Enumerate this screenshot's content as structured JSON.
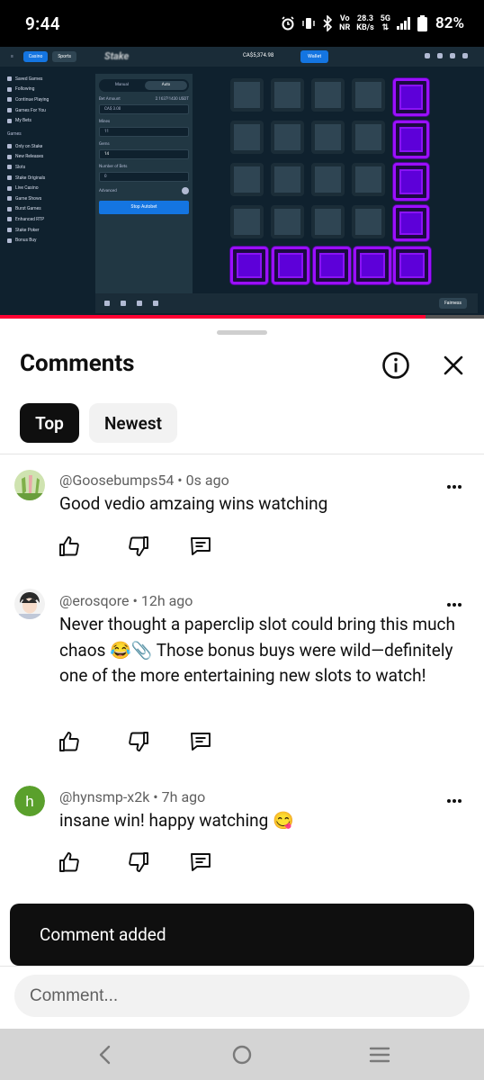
{
  "status_bar": {
    "time": "9:44",
    "net_speed_value": "28.3",
    "net_speed_unit": "KB/s",
    "vo_label": "Vo",
    "nr_label": "NR",
    "five_g_label": "5G",
    "battery": "82%"
  },
  "video": {
    "progress": 0.88,
    "stake_ui": {
      "tabs": [
        "Casino",
        "Sports"
      ],
      "logo": "Stake",
      "balance": "CA$5,374.98",
      "wallet_label": "Wallet",
      "sidebar_items": [
        "Saved Games",
        "Following",
        "Continue Playing",
        "Games For You",
        "My Bets"
      ],
      "sidebar_section": "Games",
      "sidebar_game_items": [
        "Only on Stake",
        "New Releases",
        "Slots",
        "Stake Originals",
        "Live Casino",
        "Game Shows",
        "Burst Games",
        "Enhanced RTP",
        "Stake Poker",
        "Bonus Buy"
      ],
      "mode_tabs": [
        "Manual",
        "Auto"
      ],
      "bet_amount_label": "Bet Amount",
      "bet_amount_usdt": "2.1637!1430 USDT",
      "bet_amount_value": "CA$ 3.00",
      "mines_label": "Mines",
      "mines_value": "11",
      "gems_label": "Gems",
      "gems_value": "14",
      "number_of_bets_label": "Number of Bets",
      "number_of_bets_value": "0",
      "advanced_label": "Advanced",
      "start_button": "Stop Autobet",
      "fairness_label": "Fairness"
    }
  },
  "comments_sheet": {
    "title": "Comments",
    "sort_chips": [
      "Top",
      "Newest"
    ],
    "active_chip": "Top",
    "comments": [
      {
        "author": "@Goosebumps54",
        "time": "0s ago",
        "text": "Good vedio amzaing wins watching",
        "avatar": "bunny-ears-avatar"
      },
      {
        "author": "@erosqore",
        "time": "12h ago",
        "text": "Never thought a paperclip slot could bring this much chaos 😂📎 Those bonus buys were wild—definitely one of the more entertaining new slots to watch!",
        "avatar": "anime-character-avatar"
      },
      {
        "author": "@hynsmp-x2k",
        "time": "7h ago",
        "text": "insane win! happy watching 😋",
        "avatar_letter": "h",
        "avatar_color": "#5aa02c"
      }
    ],
    "toast": "Comment added",
    "input_placeholder": "Comment..."
  },
  "colors": {
    "accent_purple": "#9b0fff",
    "stake_blue": "#1475e1",
    "progress_red": "#ff0033"
  },
  "icons": [
    "alarm-icon",
    "vibrate-icon",
    "bluetooth-icon",
    "signal-icon",
    "battery-icon",
    "info-icon",
    "close-icon",
    "like-icon",
    "dislike-icon",
    "reply-icon",
    "more-icon",
    "back-icon",
    "home-icon",
    "recents-icon"
  ]
}
